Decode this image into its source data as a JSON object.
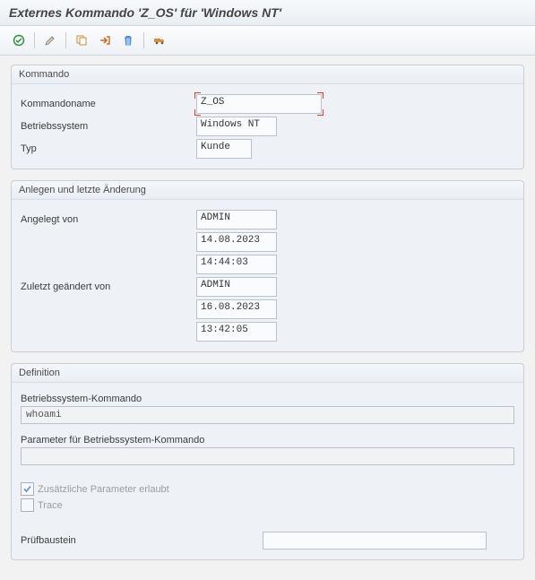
{
  "title": "Externes Kommando 'Z_OS' für 'Windows NT'",
  "group_command": {
    "legend": "Kommando",
    "name_label": "Kommandoname",
    "name_value": "Z_OS",
    "os_label": "Betriebssystem",
    "os_value": "Windows NT",
    "type_label": "Typ",
    "type_value": "Kunde"
  },
  "group_changes": {
    "legend": "Anlegen und letzte Änderung",
    "created_by_label": "Angelegt von",
    "created_by": "ADMIN",
    "created_date": "14.08.2023",
    "created_time": "14:44:03",
    "changed_by_label": "Zuletzt geändert von",
    "changed_by": "ADMIN",
    "changed_date": "16.08.2023",
    "changed_time": "13:42:05"
  },
  "group_def": {
    "legend": "Definition",
    "os_cmd_label": "Betriebssystem-Kommando",
    "os_cmd_value": "whoami",
    "param_label": "Parameter für Betriebssystem-Kommando",
    "param_value": "",
    "extra_params_label": "Zusätzliche Parameter erlaubt",
    "extra_params_checked": true,
    "trace_label": "Trace",
    "trace_checked": false,
    "pruefbaustein_label": "Prüfbaustein",
    "pruefbaustein_value": ""
  }
}
